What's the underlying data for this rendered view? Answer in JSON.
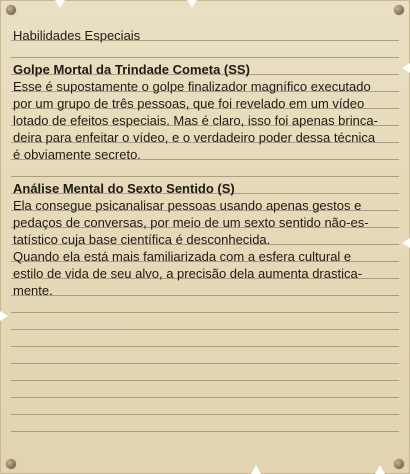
{
  "window": {
    "title": "Habilidades Especiais"
  },
  "sections": [
    {
      "title": "Golpe Mortal da Trindade Cometa (SS)",
      "lines": [
        "Esse é supostamente o golpe finalizador magnífico executado",
        "por um grupo de três pessoas, que foi revelado em um vídeo",
        "lotado de efeitos especiais. Mas é claro, isso foi apenas brinca-",
        "deira para enfeitar o vídeo, e o verdadeiro poder dessa técnica",
        "é obviamente secreto."
      ]
    },
    {
      "title": "Análise Mental do Sexto Sentido (S)",
      "lines": [
        "Ela consegue psicanalisar pessoas usando apenas gestos e",
        "pedaços de conversas, por meio de um sexto sentido não-es-",
        "tatístico cuja base científica é desconhecida.",
        "Quando ela está mais familiarizada com a esfera cultural e",
        "estilo de vida de seu alvo, a precisão dela aumenta drastica-",
        "mente."
      ]
    }
  ],
  "colors": {
    "paper": "#e6dab9",
    "rule_line": "#9c927f",
    "text": "#1f1a14",
    "nail": "#8c7763"
  }
}
